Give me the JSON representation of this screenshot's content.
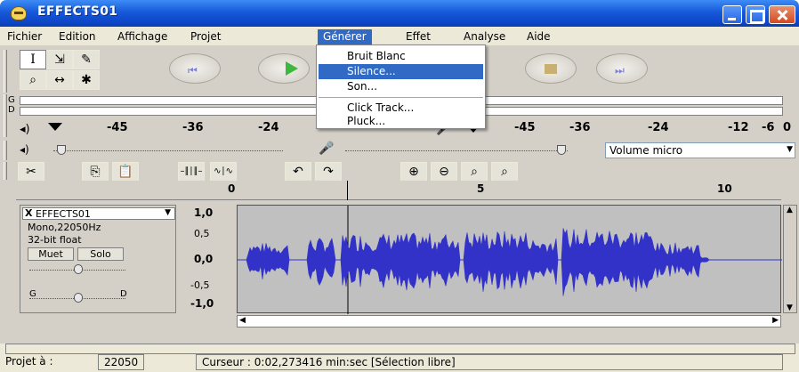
{
  "window": {
    "title": "EFFECTS01"
  },
  "menubar": {
    "items": [
      "Fichier",
      "Edition",
      "Affichage",
      "Projet",
      "Générer",
      "Effet",
      "Analyse",
      "Aide"
    ],
    "active": "Générer"
  },
  "generate_menu": {
    "items": [
      {
        "label": "Bruit Blanc",
        "selected": false
      },
      {
        "label": "Silence...",
        "selected": true
      },
      {
        "label": "Son...",
        "selected": false
      },
      {
        "label": "Click Track...",
        "selected": false
      },
      {
        "label": "Pluck...",
        "selected": false
      }
    ]
  },
  "tools": {
    "select": "I",
    "envelope": "⇲",
    "draw": "✎",
    "zoom": "⌕",
    "timeshift": "↔",
    "multi": "✱"
  },
  "meter": {
    "channel_top": "G",
    "channel_bottom": "D",
    "scale_left": [
      "-45",
      "-36",
      "-24"
    ],
    "scale_mid": [
      "-12",
      "-6",
      "0"
    ],
    "scale_right": [
      "-45",
      "-36",
      "-24",
      "-12",
      "-6",
      "0"
    ]
  },
  "mixer": {
    "input_source": "Volume micro"
  },
  "ruler": {
    "ticks": [
      "0",
      "5",
      "10"
    ]
  },
  "track": {
    "name": "EFFECTS01",
    "format": "Mono,22050Hz",
    "bitdepth": "32-bit float",
    "mute_label": "Muet",
    "solo_label": "Solo",
    "gain_label": "G",
    "pan_left": "G",
    "pan_right": "D",
    "scale": [
      "1,0",
      "0,5",
      "0,0",
      "-0,5",
      "-1,0"
    ]
  },
  "status": {
    "project_rate_label": "Projet à :",
    "project_rate": "22050",
    "cursor": "Curseur : 0:02,273416 min:sec   [Sélection libre]"
  },
  "colors": {
    "titlebar": "#0d45c6",
    "selection": "#316ac5",
    "waveform": "#3232c8",
    "track_bg": "#c0c0c0"
  }
}
